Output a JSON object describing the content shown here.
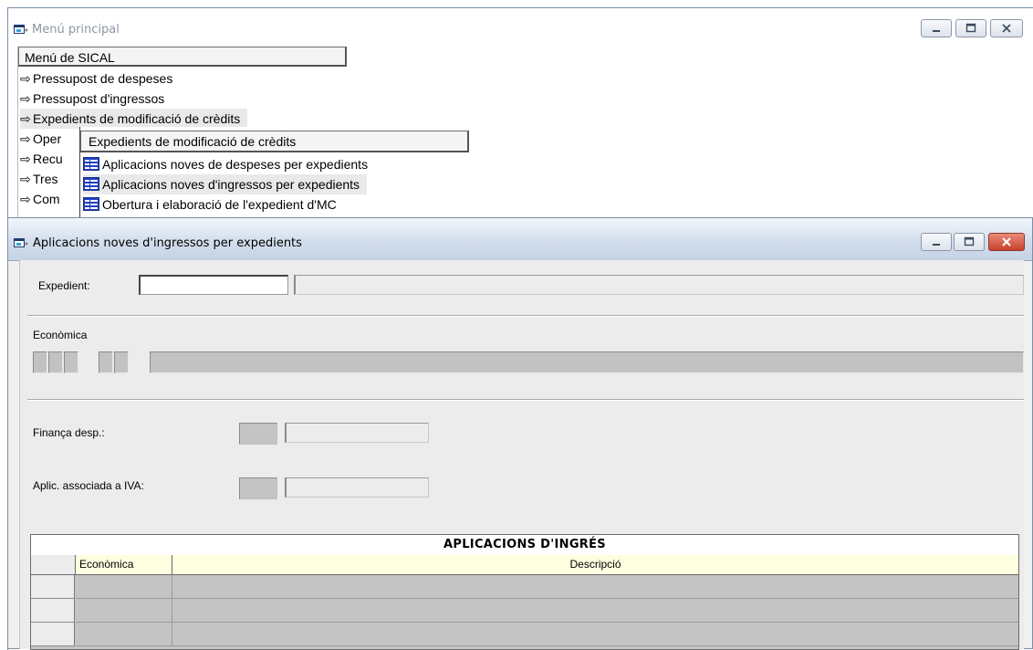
{
  "main_window": {
    "title": "Menú principal",
    "menu": {
      "header": "Menú de SICAL",
      "items": [
        {
          "arrow": "⇨",
          "label": "Pressupost de despeses"
        },
        {
          "arrow": "⇨",
          "label": "Pressupost d'ingressos"
        },
        {
          "arrow": "⇨",
          "label": "Expedients de modificació de crèdits"
        },
        {
          "arrow": "⇨",
          "label": "Oper"
        },
        {
          "arrow": "⇨",
          "label": "Recu"
        },
        {
          "arrow": "⇨",
          "label": "Tres"
        },
        {
          "arrow": "⇨",
          "label": "Com"
        }
      ]
    },
    "submenu": {
      "header": "Expedients de modificació de crèdits",
      "items": [
        {
          "label": "Aplicacions noves de despeses per expedients"
        },
        {
          "label": "Aplicacions noves d'ingressos per expedients"
        },
        {
          "label": "Obertura i elaboració de l'expedient d'MC"
        }
      ]
    }
  },
  "child_window": {
    "title": "Aplicacions noves d'ingressos per expedients",
    "form": {
      "expedient_label": "Expedient:",
      "expedient_value": "",
      "expedient_desc": "",
      "economica_label": "Econòmica",
      "financa_label": "Finança desp.:",
      "iva_label": "Aplic. associada a IVA:"
    },
    "grid": {
      "title": "APLICACIONS D'INGRÉS",
      "columns": [
        "Econòmica",
        "Descripció"
      ],
      "row_count": 3
    }
  },
  "colors": {
    "accent_blue": "#1f3fbf",
    "grid_header_bg": "#fefee0",
    "close_button_red": "#c7422b"
  },
  "icons": [
    "app-window-icon",
    "minimize-icon",
    "restore-icon",
    "close-icon",
    "arrow-right-icon",
    "form-icon"
  ]
}
